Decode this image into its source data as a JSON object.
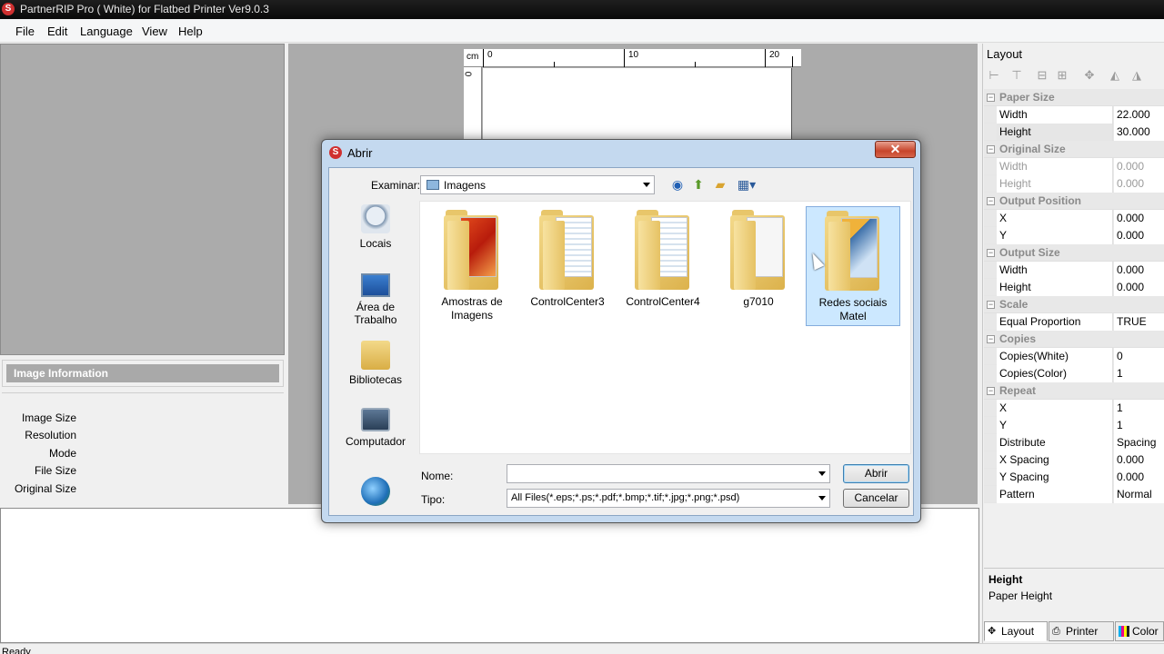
{
  "app": {
    "title": "PartnerRIP Pro ( White) for Flatbed Printer Ver9.0.3",
    "icon": "partnerrip-logo-icon"
  },
  "menu": {
    "file": "File",
    "edit": "Edit",
    "language": "Language",
    "view": "View",
    "help": "Help"
  },
  "image_info": {
    "header": "Image Information",
    "labels": [
      "Image Size",
      "Resolution",
      "Mode",
      "File Size",
      "Original Size"
    ]
  },
  "ruler": {
    "unit": "cm",
    "top_labels": [
      "0",
      "10",
      "20"
    ],
    "left_labels": [
      "0"
    ]
  },
  "status": {
    "text": "Ready"
  },
  "layout_panel": {
    "title": "Layout",
    "toolbar_icons": [
      "align-left-icon",
      "align-top-icon",
      "center-horizontal-icon",
      "center-vertical-icon",
      "center-icon",
      "flip-horizontal-icon",
      "flip-vertical-icon"
    ],
    "categories": [
      {
        "name": "Paper Size",
        "rows": [
          {
            "label": "Width",
            "value": "22.000"
          },
          {
            "label": "Height",
            "value": "30.000",
            "selected": true
          }
        ]
      },
      {
        "name": "Original Size",
        "disabled": true,
        "rows": [
          {
            "label": "Width",
            "value": "0.000"
          },
          {
            "label": "Height",
            "value": "0.000"
          }
        ]
      },
      {
        "name": "Output Position",
        "rows": [
          {
            "label": "X",
            "value": "0.000"
          },
          {
            "label": "Y",
            "value": "0.000"
          }
        ]
      },
      {
        "name": "Output Size",
        "rows": [
          {
            "label": "Width",
            "value": "0.000"
          },
          {
            "label": "Height",
            "value": "0.000"
          }
        ]
      },
      {
        "name": "Scale",
        "rows": [
          {
            "label": "Equal Proportion",
            "value": "TRUE"
          }
        ]
      },
      {
        "name": "Copies",
        "rows": [
          {
            "label": "Copies(White)",
            "value": "0"
          },
          {
            "label": "Copies(Color)",
            "value": "1"
          }
        ]
      },
      {
        "name": "Repeat",
        "rows": [
          {
            "label": "X",
            "value": "1"
          },
          {
            "label": "Y",
            "value": "1"
          },
          {
            "label": "Distribute",
            "value": "Spacing"
          },
          {
            "label": "X Spacing",
            "value": "0.000"
          },
          {
            "label": "Y Spacing",
            "value": "0.000"
          },
          {
            "label": "Pattern",
            "value": "Normal"
          }
        ]
      }
    ],
    "description": {
      "title": "Height",
      "text": "Paper Height"
    },
    "tabs": {
      "layout": "Layout",
      "printer": "Printer",
      "color": "Color"
    }
  },
  "dialog": {
    "title": "Abrir",
    "close": "✕",
    "look_in_label": "Examinar:",
    "look_in_value": "Imagens",
    "places": [
      {
        "label": "Locais",
        "icon": "recent-places-icon"
      },
      {
        "label": "Área de Trabalho",
        "icon": "desktop-icon"
      },
      {
        "label": "Bibliotecas",
        "icon": "libraries-icon"
      },
      {
        "label": "Computador",
        "icon": "computer-icon"
      },
      {
        "label": "",
        "icon": "network-icon"
      }
    ],
    "files": [
      {
        "name": "Amostras de Imagens"
      },
      {
        "name": "ControlCenter3"
      },
      {
        "name": "ControlCenter4"
      },
      {
        "name": "g7010"
      },
      {
        "name": "Redes sociais Matel",
        "selected": true
      }
    ],
    "name_label": "Nome:",
    "name_value": "",
    "type_label": "Tipo:",
    "type_value": "All Files(*.eps;*.ps;*.pdf;*.bmp;*.tif;*.jpg;*.png;*.psd)",
    "open_button": "Abrir",
    "cancel_button": "Cancelar"
  }
}
